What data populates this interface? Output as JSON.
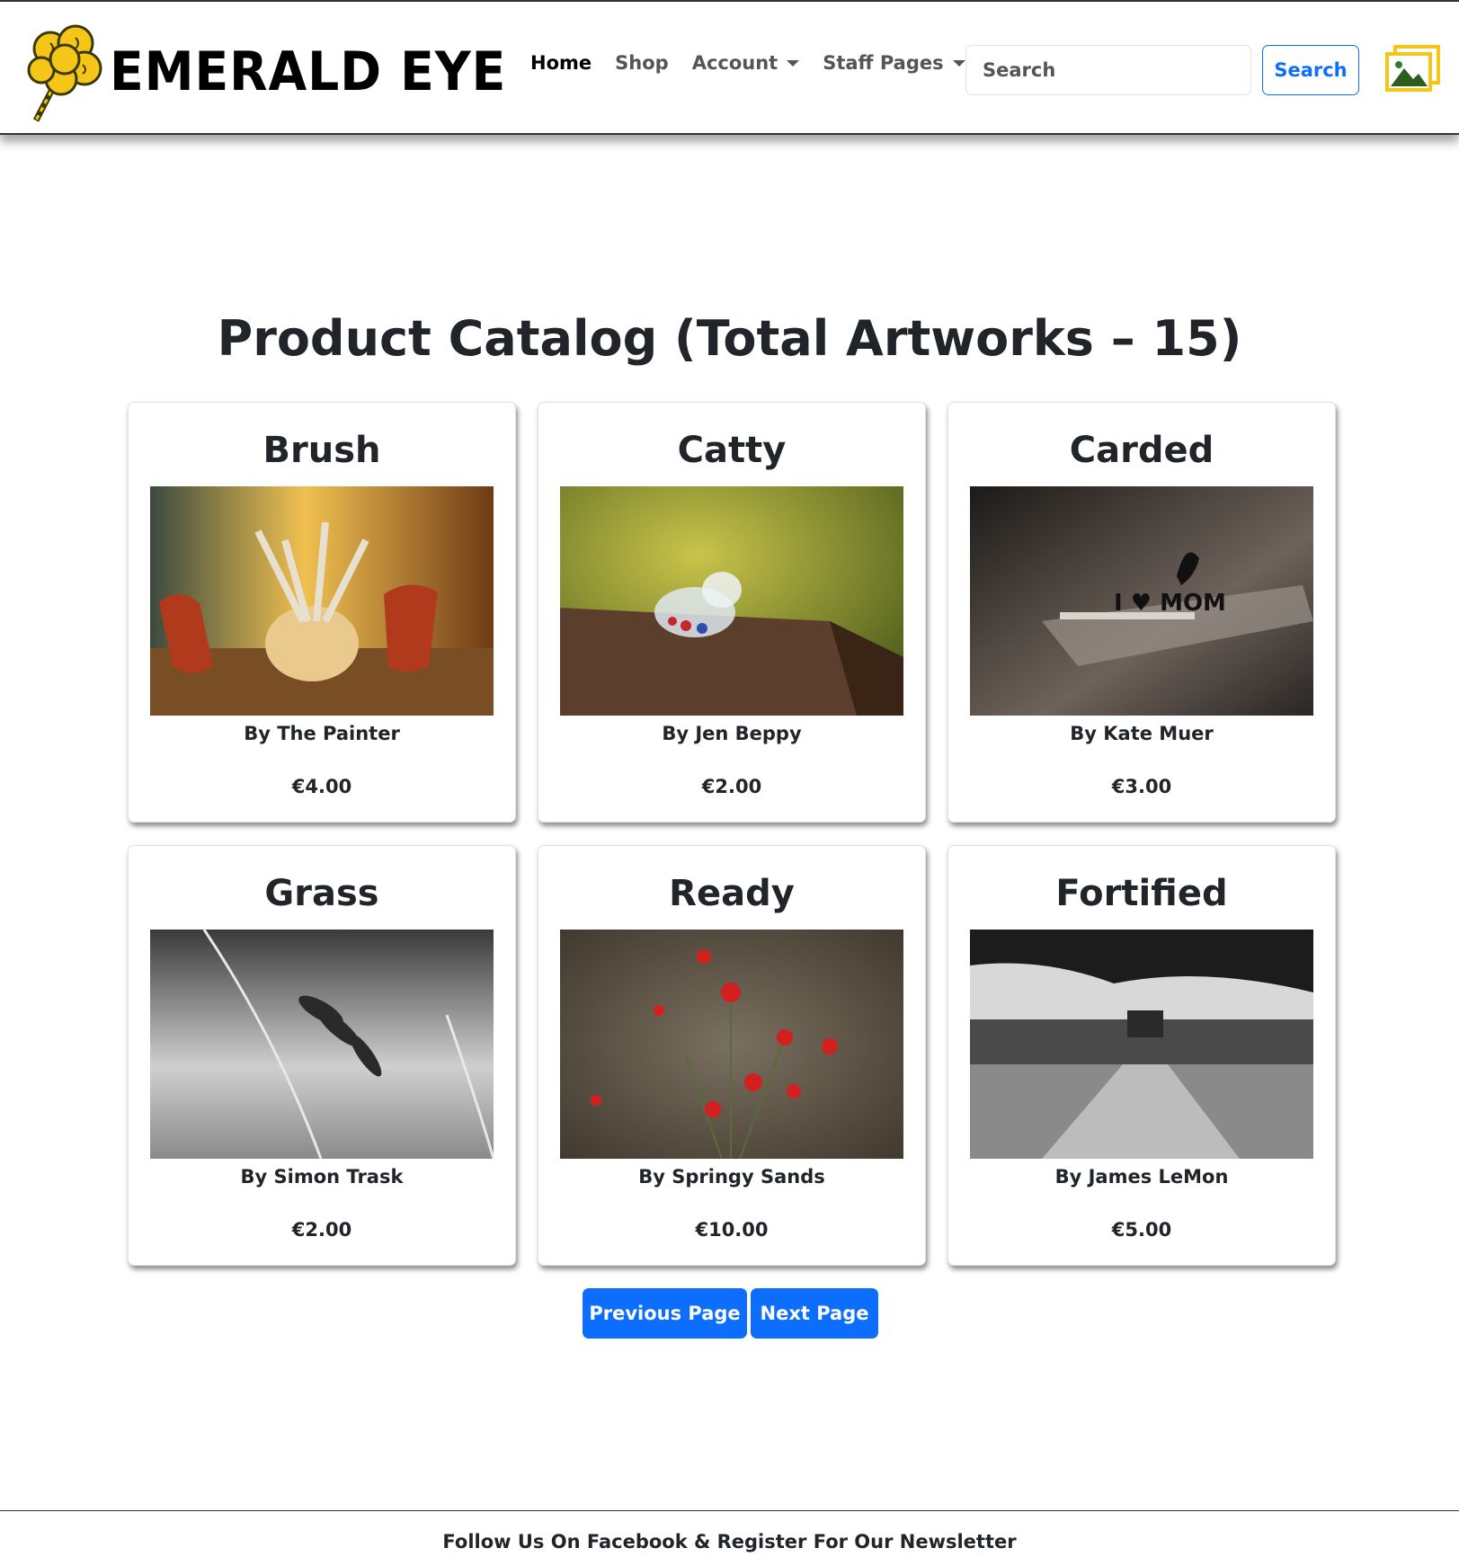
{
  "brand": {
    "name": "EMERALD EYE"
  },
  "nav": {
    "home": "Home",
    "shop": "Shop",
    "account": "Account",
    "staff": "Staff Pages"
  },
  "search": {
    "placeholder": "Search",
    "button": "Search"
  },
  "page": {
    "title": "Product Catalog (Total Artworks – 15)"
  },
  "products": [
    {
      "title": "Brush",
      "artist": "By The Painter",
      "price": "€4.00"
    },
    {
      "title": "Catty",
      "artist": "By Jen Beppy",
      "price": "€2.00"
    },
    {
      "title": "Carded",
      "artist": "By Kate Muer",
      "price": "€3.00"
    },
    {
      "title": "Grass",
      "artist": "By Simon Trask",
      "price": "€2.00"
    },
    {
      "title": "Ready",
      "artist": "By Springy Sands",
      "price": "€10.00"
    },
    {
      "title": "Fortified",
      "artist": "By James LeMon",
      "price": "€5.00"
    }
  ],
  "pagination": {
    "previous": "Previous Page",
    "next": "Next Page"
  },
  "footer": {
    "text": "Follow Us On Facebook & Register For Our Newsletter"
  },
  "colors": {
    "accent": "#0d6efd",
    "logo_yellow": "#f5c518",
    "logo_green": "#2e7d32"
  },
  "icons": {
    "logo": "clover-logo-icon",
    "gallery": "gallery-icon",
    "caret": "caret-down-icon"
  }
}
